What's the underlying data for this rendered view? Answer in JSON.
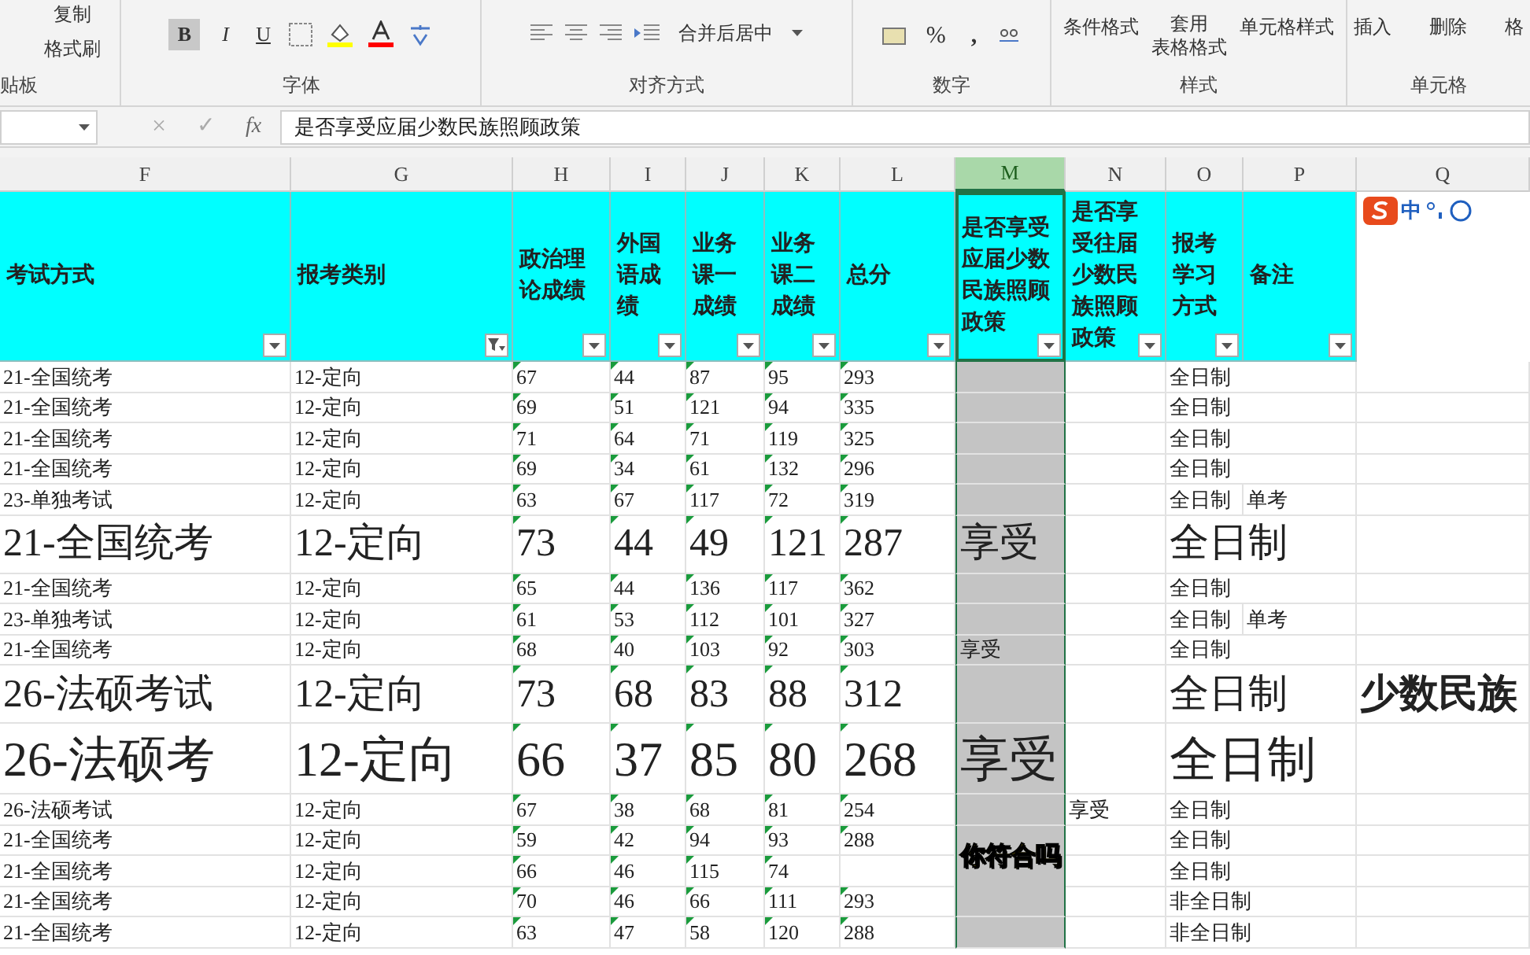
{
  "ribbon": {
    "clipboard": {
      "copy": "复制",
      "format_painter": "格式刷",
      "label": "贴板"
    },
    "font": {
      "bold": "B",
      "italic": "I",
      "underline": "U",
      "label": "字体"
    },
    "alignment": {
      "merge": "合并后居中",
      "label": "对齐方式"
    },
    "number": {
      "percent": "%",
      "comma": ",",
      "label": "数字"
    },
    "styles": {
      "conditional": "条件格式",
      "table_format_1": "套用",
      "table_format_2": "表格格式",
      "cell_styles": "单元格样式",
      "label": "样式"
    },
    "cells": {
      "insert": "插入",
      "delete": "删除",
      "format": "格",
      "label": "单元格"
    }
  },
  "formula_bar": {
    "cancel": "×",
    "enter": "✓",
    "fx": "fx",
    "content": "是否享受应届少数民族照顾政策"
  },
  "column_letters": [
    {
      "label": "F",
      "selected": false
    },
    {
      "label": "G",
      "selected": false
    },
    {
      "label": "H",
      "selected": false
    },
    {
      "label": "I",
      "selected": false
    },
    {
      "label": "J",
      "selected": false
    },
    {
      "label": "K",
      "selected": false
    },
    {
      "label": "L",
      "selected": false
    },
    {
      "label": "M",
      "selected": true
    },
    {
      "label": "N",
      "selected": false
    },
    {
      "label": "O",
      "selected": false
    },
    {
      "label": "P",
      "selected": false
    },
    {
      "label": "Q",
      "selected": false
    }
  ],
  "header_cells": [
    {
      "text": "考试方式",
      "filtered": false
    },
    {
      "text": "报考类别",
      "filtered": true
    },
    {
      "text": "政治理论成绩",
      "filtered": false
    },
    {
      "text": "外国语成绩",
      "filtered": false
    },
    {
      "text": "业务课一成绩",
      "filtered": false
    },
    {
      "text": "业务课二成绩",
      "filtered": false
    },
    {
      "text": "总分",
      "filtered": false
    },
    {
      "text": "是否享受应届少数民族照顾政策",
      "filtered": false
    },
    {
      "text": "是否享受往届少数民族照顾政策",
      "filtered": false
    },
    {
      "text": "报考学习方式",
      "filtered": false
    },
    {
      "text": "备注",
      "filtered": false
    }
  ],
  "ime": {
    "label": "中"
  },
  "rows": [
    {
      "kind": "normal",
      "cells": [
        "21-全国统考",
        "12-定向",
        "67",
        "44",
        "87",
        "95",
        "293",
        "",
        "",
        "全日制",
        "",
        ""
      ]
    },
    {
      "kind": "normal",
      "cells": [
        "21-全国统考",
        "12-定向",
        "69",
        "51",
        "121",
        "94",
        "335",
        "",
        "",
        "全日制",
        "",
        ""
      ]
    },
    {
      "kind": "normal",
      "cells": [
        "21-全国统考",
        "12-定向",
        "71",
        "64",
        "71",
        "119",
        "325",
        "",
        "",
        "全日制",
        "",
        ""
      ]
    },
    {
      "kind": "normal",
      "cells": [
        "21-全国统考",
        "12-定向",
        "69",
        "34",
        "61",
        "132",
        "296",
        "",
        "",
        "全日制",
        "",
        ""
      ]
    },
    {
      "kind": "normal",
      "cells": [
        "23-单独考试",
        "12-定向",
        "63",
        "67",
        "117",
        "72",
        "319",
        "",
        "",
        "全日制",
        "单考",
        ""
      ]
    },
    {
      "kind": "large",
      "cells": [
        "21-全国统考",
        "12-定向",
        "73",
        "44",
        "49",
        "121",
        "287",
        "享受",
        "",
        "全日制",
        "",
        ""
      ]
    },
    {
      "kind": "normal",
      "cells": [
        "21-全国统考",
        "12-定向",
        "65",
        "44",
        "136",
        "117",
        "362",
        "",
        "",
        "全日制",
        "",
        ""
      ]
    },
    {
      "kind": "normal",
      "cells": [
        "23-单独考试",
        "12-定向",
        "61",
        "53",
        "112",
        "101",
        "327",
        "",
        "",
        "全日制",
        "单考",
        ""
      ]
    },
    {
      "kind": "normal",
      "cells": [
        "21-全国统考",
        "12-定向",
        "68",
        "40",
        "103",
        "92",
        "303",
        "享受",
        "",
        "全日制",
        "",
        ""
      ]
    },
    {
      "kind": "large",
      "cells": [
        "26-法硕考试",
        "12-定向",
        "73",
        "68",
        "83",
        "88",
        "312",
        "",
        "",
        "全日制",
        "",
        "少数民族"
      ]
    },
    {
      "kind": "xlarge",
      "cells": [
        "26-法硕考",
        "12-定向",
        "66",
        "37",
        "85",
        "80",
        "268",
        "享受",
        "",
        "全日制",
        "",
        ""
      ]
    },
    {
      "kind": "normal",
      "cells": [
        "26-法硕考试",
        "12-定向",
        "67",
        "38",
        "68",
        "81",
        "254",
        "",
        "享受",
        "全日制",
        "",
        ""
      ]
    },
    {
      "kind": "normal",
      "cells": [
        "21-全国统考",
        "12-定向",
        "59",
        "42",
        "94",
        "93",
        "288",
        "",
        "",
        "全日制",
        "",
        ""
      ]
    },
    {
      "kind": "normal",
      "cells": [
        "21-全国统考",
        "12-定向",
        "66",
        "46",
        "115",
        "74",
        "",
        "",
        "",
        "全日制",
        "",
        ""
      ]
    },
    {
      "kind": "normal",
      "cells": [
        "21-全国统考",
        "12-定向",
        "70",
        "46",
        "66",
        "111",
        "293",
        "",
        "",
        "非全日制",
        "",
        ""
      ]
    },
    {
      "kind": "normal",
      "cells": [
        "21-全国统考",
        "12-定向",
        "63",
        "47",
        "58",
        "120",
        "288",
        "",
        "",
        "非全日制",
        "",
        ""
      ]
    }
  ],
  "caption": "你符合吗"
}
